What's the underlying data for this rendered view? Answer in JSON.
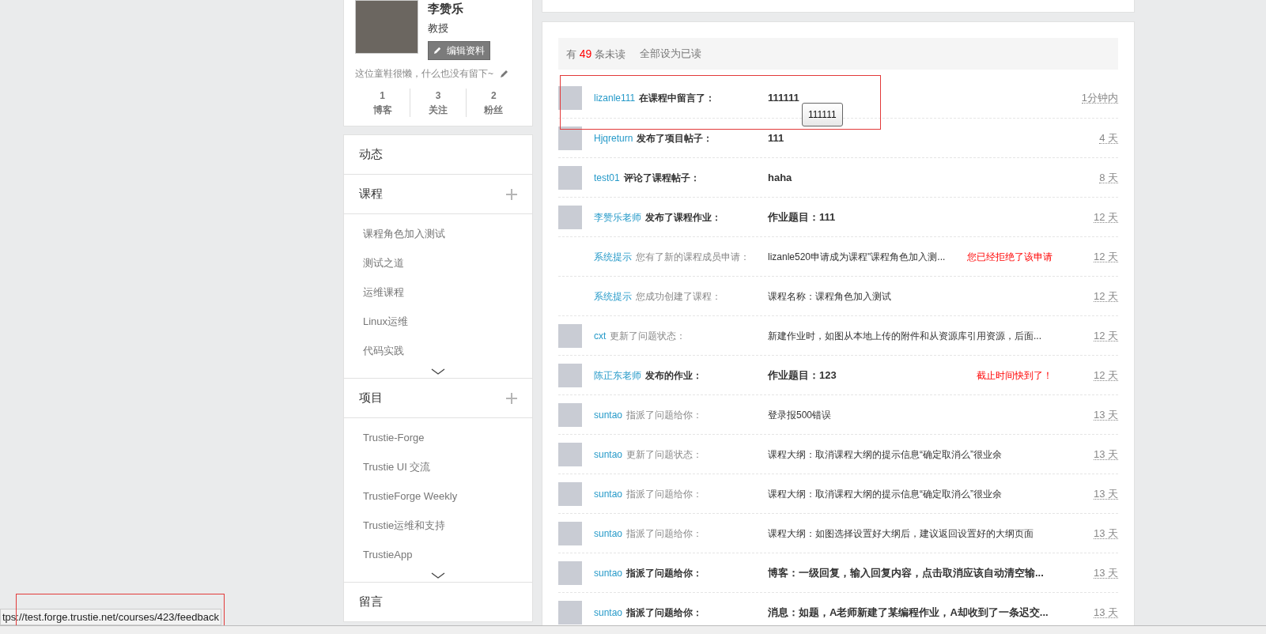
{
  "profile": {
    "name": "李赞乐",
    "title": "教授",
    "edit_button": "编辑资料",
    "bio": "这位童鞋很懒，什么也没有留下~",
    "stats": [
      {
        "value": "1",
        "label": "博客"
      },
      {
        "value": "3",
        "label": "关注"
      },
      {
        "value": "2",
        "label": "粉丝"
      }
    ]
  },
  "sidebar": {
    "sections": [
      {
        "title": "动态",
        "addable": false
      },
      {
        "title": "课程",
        "addable": true,
        "items": [
          "课程角色加入测试",
          "测试之道",
          "运维课程",
          "Linux运维",
          "代码实践"
        ]
      },
      {
        "title": "项目",
        "addable": true,
        "items": [
          "Trustie-Forge",
          "Trustie UI 交流",
          "TrustieForge Weekly",
          "Trustie运维和支持",
          "TrustieApp"
        ]
      },
      {
        "title": "留言",
        "addable": false
      }
    ]
  },
  "messages": {
    "summary": {
      "prefix": "有",
      "count": "49",
      "suffix": "条未读"
    },
    "mark_all_read": "全部设为已读",
    "rows": [
      {
        "avatar": true,
        "user": "lizanle111",
        "action": "在课程中留言了：",
        "content": "111111",
        "time": "1分钟内",
        "unread": true
      },
      {
        "avatar": true,
        "user": "Hjqreturn",
        "action": "发布了项目帖子：",
        "content": "111",
        "time": "4 天",
        "unread": true
      },
      {
        "avatar": true,
        "user": "test01",
        "action": "评论了课程帖子：",
        "content": "haha",
        "time": "8 天",
        "unread": true
      },
      {
        "avatar": true,
        "user": "李赞乐老师",
        "action": "发布了课程作业：",
        "content": "作业题目：111",
        "time": "12 天",
        "unread": true
      },
      {
        "avatar": false,
        "user": "系统提示",
        "action": "您有了新的课程成员申请：",
        "content": "lizanle520申请成为课程\"课程角色加入测...",
        "notice": "您已经拒绝了该申请",
        "time": "12 天",
        "unread": false
      },
      {
        "avatar": false,
        "user": "系统提示",
        "action": "您成功创建了课程：",
        "content": "课程名称：课程角色加入测试",
        "time": "12 天",
        "unread": false
      },
      {
        "avatar": true,
        "user": "cxt",
        "action": "更新了问题状态：",
        "content": "新建作业时，如图从本地上传的附件和从资源库引用资源，后面...",
        "time": "12 天",
        "unread": false
      },
      {
        "avatar": true,
        "user": "陈正东老师",
        "action": "发布的作业：",
        "content": "作业题目：123",
        "notice": "截止时间快到了！",
        "time": "12 天",
        "unread": true
      },
      {
        "avatar": true,
        "user": "suntao",
        "action": "指派了问题给你：",
        "content": "登录报500错误",
        "time": "13 天",
        "unread": false
      },
      {
        "avatar": true,
        "user": "suntao",
        "action": "更新了问题状态：",
        "content": "课程大纲：取消课程大纲的提示信息“确定取消么”很业余",
        "time": "13 天",
        "unread": false
      },
      {
        "avatar": true,
        "user": "suntao",
        "action": "指派了问题给你：",
        "content": "课程大纲：取消课程大纲的提示信息“确定取消么”很业余",
        "time": "13 天",
        "unread": false
      },
      {
        "avatar": true,
        "user": "suntao",
        "action": "指派了问题给你：",
        "content": "课程大纲：如图选择设置好大纲后，建议返回设置好的大纲页面",
        "time": "13 天",
        "unread": false
      },
      {
        "avatar": true,
        "user": "suntao",
        "action": "指派了问题给你：",
        "content": "博客：一级回复，输入回复内容，点击取消应该自动清空输...",
        "time": "13 天",
        "unread": true
      },
      {
        "avatar": true,
        "user": "suntao",
        "action": "指派了问题给你：",
        "content": "消息：如题，A老师新建了某编程作业，A却收到了一条迟交...",
        "time": "13 天",
        "unread": true
      }
    ]
  },
  "tooltip": "111111",
  "status_url": "tps://test.forge.trustie.net/courses/423/feedback"
}
